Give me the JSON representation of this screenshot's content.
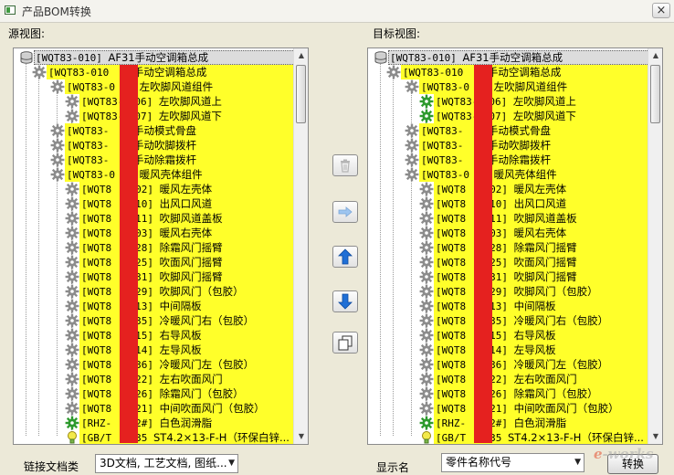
{
  "window": {
    "title": "产品BOM转换",
    "close_glyph": "×"
  },
  "source_label": "源视图:",
  "target_label": "目标视图:",
  "colors": {
    "highlight": "#ffff2a",
    "redact": "#e5211f",
    "gear": "#8c8c8c",
    "gear_green": "#2e9a2e"
  },
  "source_tree": [
    {
      "indent": 0,
      "icon": "db",
      "code": "[WQT83-010]",
      "tail": "AF31手动空调箱总成",
      "root": true
    },
    {
      "indent": 1,
      "icon": "gear",
      "code": "[WQT83-010",
      "tail": "手动空调箱总成"
    },
    {
      "indent": 2,
      "icon": "gear",
      "code": "[WQT83-0",
      "tail": "左吹脚风道组件"
    },
    {
      "indent": 3,
      "icon": "gear",
      "code": "[WQT83-",
      "mid": "06]",
      "tail": "左吹脚风道上"
    },
    {
      "indent": 3,
      "icon": "gear",
      "code": "[WQT83-",
      "mid": "07]",
      "tail": "左吹脚风道下"
    },
    {
      "indent": 2,
      "icon": "gear",
      "code": "[WQT83-",
      "tail": "手动模式骨盘"
    },
    {
      "indent": 2,
      "icon": "gear",
      "code": "[WQT83-",
      "tail": "手动吹脚拨杆"
    },
    {
      "indent": 2,
      "icon": "gear",
      "code": "[WQT83-",
      "tail": "手动除霜拨杆"
    },
    {
      "indent": 2,
      "icon": "gear",
      "code": "[WQT83-0",
      "tail": "暖风壳体组件"
    },
    {
      "indent": 3,
      "icon": "gear",
      "code": "[WQT8",
      "mid": "02]",
      "tail": "暖风左壳体"
    },
    {
      "indent": 3,
      "icon": "gear",
      "code": "[WQT8",
      "mid": "10]",
      "tail": "出风口风道"
    },
    {
      "indent": 3,
      "icon": "gear",
      "code": "[WQT8",
      "mid": "11]",
      "tail": "吹脚风道盖板"
    },
    {
      "indent": 3,
      "icon": "gear",
      "code": "[WQT8",
      "mid": "03]",
      "tail": "暖风右壳体"
    },
    {
      "indent": 3,
      "icon": "gear",
      "code": "[WQT8",
      "mid": "28]",
      "tail": "除霜风门摇臂"
    },
    {
      "indent": 3,
      "icon": "gear",
      "code": "[WQT8",
      "mid": "25]",
      "tail": "吹面风门摇臂"
    },
    {
      "indent": 3,
      "icon": "gear",
      "code": "[WQT8",
      "mid": "31]",
      "tail": "吹脚风门摇臂"
    },
    {
      "indent": 3,
      "icon": "gear",
      "code": "[WQT8",
      "mid": "29]",
      "tail": "吹脚风门（包胶）"
    },
    {
      "indent": 3,
      "icon": "gear",
      "code": "[WQT8",
      "mid": "13]",
      "tail": "中间隔板"
    },
    {
      "indent": 3,
      "icon": "gear",
      "code": "[WQT8",
      "mid": "35]",
      "tail": "冷暖风门右（包胶）"
    },
    {
      "indent": 3,
      "icon": "gear",
      "code": "[WQT8",
      "mid": "15]",
      "tail": "右导风板"
    },
    {
      "indent": 3,
      "icon": "gear",
      "code": "[WQT8",
      "mid": "14]",
      "tail": "左导风板"
    },
    {
      "indent": 3,
      "icon": "gear",
      "code": "[WQT8",
      "mid": "36]",
      "tail": "冷暖风门左（包胶）"
    },
    {
      "indent": 3,
      "icon": "gear",
      "code": "[WQT8",
      "mid": "22]",
      "tail": "左右吹面风门"
    },
    {
      "indent": 3,
      "icon": "gear",
      "code": "[WQT8",
      "mid": "26]",
      "tail": "除霜风门（包胶）"
    },
    {
      "indent": 3,
      "icon": "gear",
      "code": "[WQT8",
      "mid": "21]",
      "tail": "中间吹面风门（包胶）"
    },
    {
      "indent": 3,
      "icon": "gear_green",
      "code": "[RHZ-",
      "mid": "2#]",
      "tail": "白色润滑脂"
    },
    {
      "indent": 3,
      "icon": "bulb",
      "code": "[GB/T",
      "mid": "35",
      "tail": "ST4.2×13-F-H（环保白锌..."
    }
  ],
  "target_tree": [
    {
      "indent": 0,
      "icon": "db",
      "code": "[WQT83-010]",
      "tail": "AF31手动空调箱总成",
      "root": true
    },
    {
      "indent": 1,
      "icon": "gear",
      "code": "[WQT83-010",
      "tail": "手动空调箱总成"
    },
    {
      "indent": 2,
      "icon": "gear",
      "code": "[WQT83-0",
      "tail": "左吹脚风道组件"
    },
    {
      "indent": 3,
      "icon": "gear_green",
      "code": "[WQT83-",
      "mid": "06]",
      "tail": "左吹脚风道上"
    },
    {
      "indent": 3,
      "icon": "gear_green",
      "code": "[WQT83-",
      "mid": "07]",
      "tail": "左吹脚风道下"
    },
    {
      "indent": 2,
      "icon": "gear",
      "code": "[WQT83-",
      "tail": "手动模式骨盘"
    },
    {
      "indent": 2,
      "icon": "gear",
      "code": "[WQT83-",
      "tail": "手动吹脚拨杆"
    },
    {
      "indent": 2,
      "icon": "gear",
      "code": "[WQT83-",
      "tail": "手动除霜拨杆"
    },
    {
      "indent": 2,
      "icon": "gear",
      "code": "[WQT83-0",
      "tail": "暖风壳体组件"
    },
    {
      "indent": 3,
      "icon": "gear",
      "code": "[WQT8",
      "mid": "02]",
      "tail": "暖风左壳体"
    },
    {
      "indent": 3,
      "icon": "gear",
      "code": "[WQT8",
      "mid": "10]",
      "tail": "出风口风道"
    },
    {
      "indent": 3,
      "icon": "gear",
      "code": "[WQT8",
      "mid": "11]",
      "tail": "吹脚风道盖板"
    },
    {
      "indent": 3,
      "icon": "gear",
      "code": "[WQT8",
      "mid": "03]",
      "tail": "暖风右壳体"
    },
    {
      "indent": 3,
      "icon": "gear",
      "code": "[WQT8",
      "mid": "28]",
      "tail": "除霜风门摇臂"
    },
    {
      "indent": 3,
      "icon": "gear",
      "code": "[WQT8",
      "mid": "25]",
      "tail": "吹面风门摇臂"
    },
    {
      "indent": 3,
      "icon": "gear",
      "code": "[WQT8",
      "mid": "31]",
      "tail": "吹脚风门摇臂"
    },
    {
      "indent": 3,
      "icon": "gear",
      "code": "[WQT8",
      "mid": "29]",
      "tail": "吹脚风门（包胶）"
    },
    {
      "indent": 3,
      "icon": "gear",
      "code": "[WQT8",
      "mid": "13]",
      "tail": "中间隔板"
    },
    {
      "indent": 3,
      "icon": "gear",
      "code": "[WQT8",
      "mid": "35]",
      "tail": "冷暖风门右（包胶）"
    },
    {
      "indent": 3,
      "icon": "gear",
      "code": "[WQT8",
      "mid": "15]",
      "tail": "右导风板"
    },
    {
      "indent": 3,
      "icon": "gear",
      "code": "[WQT8",
      "mid": "14]",
      "tail": "左导风板"
    },
    {
      "indent": 3,
      "icon": "gear",
      "code": "[WQT8",
      "mid": "36]",
      "tail": "冷暖风门左（包胶）"
    },
    {
      "indent": 3,
      "icon": "gear",
      "code": "[WQT8",
      "mid": "22]",
      "tail": "左右吹面风门"
    },
    {
      "indent": 3,
      "icon": "gear",
      "code": "[WQT8",
      "mid": "26]",
      "tail": "除霜风门（包胶）"
    },
    {
      "indent": 3,
      "icon": "gear",
      "code": "[WQT8",
      "mid": "21]",
      "tail": "中间吹面风门（包胶）"
    },
    {
      "indent": 3,
      "icon": "gear_green",
      "code": "[RHZ-",
      "mid": "2#]",
      "tail": "白色润滑脂"
    },
    {
      "indent": 3,
      "icon": "bulb",
      "code": "[GB/T",
      "mid": "35",
      "tail": "ST4.2×13-F-H（环保白锌..."
    }
  ],
  "middle_buttons": [
    {
      "name": "delete-button",
      "icon": "trash-icon",
      "enabled": false
    },
    {
      "name": "move-right-button",
      "icon": "arrow-right-icon",
      "enabled": false
    },
    {
      "name": "move-up-button",
      "icon": "arrow-up-icon",
      "enabled": true
    },
    {
      "name": "move-down-button",
      "icon": "arrow-down-icon",
      "enabled": true
    },
    {
      "name": "copy-button",
      "icon": "copy-icon",
      "enabled": true
    }
  ],
  "bottom": {
    "link_doc_label": "链接文档类",
    "link_doc_value": "3D文档, 工艺文档, 图纸...",
    "display_label": "显示名",
    "display_value": "零件名称代号",
    "convert_button": "转换",
    "dropdown_glyph": "▼"
  },
  "watermark": {
    "prefix": "e",
    "text": "-works"
  }
}
